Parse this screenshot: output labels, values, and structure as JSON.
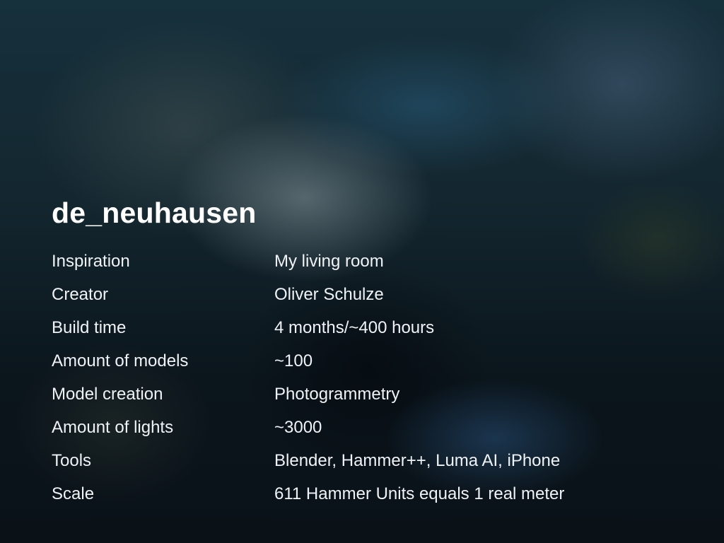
{
  "title": "de_neuhausen",
  "rows": [
    {
      "label": "Inspiration",
      "value": "My living room"
    },
    {
      "label": "Creator",
      "value": "Oliver Schulze"
    },
    {
      "label": "Build time",
      "value": "4 months/~400 hours"
    },
    {
      "label": "Amount of models",
      "value": "~100"
    },
    {
      "label": "Model creation",
      "value": "Photogrammetry"
    },
    {
      "label": "Amount of lights",
      "value": "~3000"
    },
    {
      "label": "Tools",
      "value": "Blender, Hammer++, Luma AI, iPhone"
    },
    {
      "label": "Scale",
      "value": "611 Hammer Units equals 1 real meter"
    }
  ]
}
